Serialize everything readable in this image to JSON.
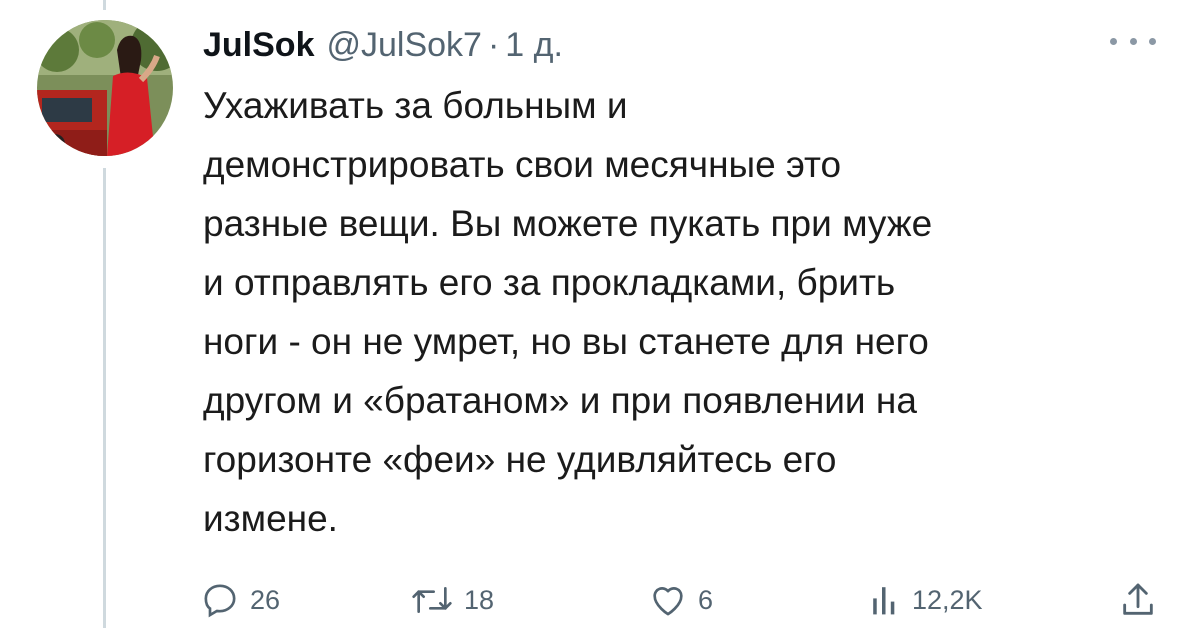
{
  "tweet": {
    "author": {
      "display_name": "JulSok",
      "handle": "@JulSok7",
      "separator": "·",
      "time_ago": "1 д."
    },
    "body_lines": [
      "Ухаживать за больным и",
      "демонстрировать свои месячные это",
      "разные вещи.  Вы можете пукать при муже",
      "и отправлять его за прокладками, брить",
      "ноги - он не умрет, но вы станете для него",
      "другом и «братаном» и при появлении на",
      "горизонте «феи» не удивляйтесь его",
      "измене."
    ],
    "metrics": {
      "replies": "26",
      "reposts": "18",
      "likes": "6",
      "views": "12,2K"
    },
    "icons": {
      "more": "more-options-icon",
      "reply": "reply-icon",
      "repost": "repost-icon",
      "like": "like-icon",
      "views": "views-icon",
      "share": "share-icon"
    }
  }
}
